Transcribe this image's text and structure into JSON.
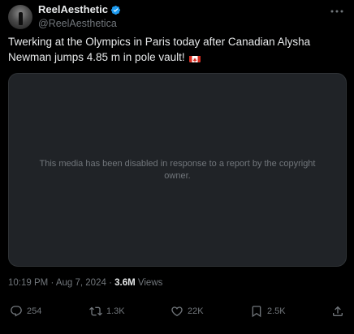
{
  "author": {
    "display_name": "ReelAesthetic",
    "handle": "@ReelAesthetica",
    "verified_icon": "verified-badge-icon",
    "avatar_icon": "profile-avatar"
  },
  "tweet": {
    "text": "Twerking at the Olympics in Paris today after Canadian Alysha Newman jumps 4.85 m in pole vault! ",
    "flag_icon": "canada-flag-icon"
  },
  "media": {
    "message": "This media has been disabled in response to a report by the copyright owner."
  },
  "meta": {
    "time": "10:19 PM",
    "separator": "·",
    "date": "Aug 7, 2024",
    "views_count": "3.6M",
    "views_label": "Views"
  },
  "actions": {
    "replies": "254",
    "reposts": "1.3K",
    "likes": "22K",
    "bookmarks": "2.5K"
  },
  "colors": {
    "background": "#000000",
    "primary_text": "#e7e9ea",
    "secondary_text": "#71767b",
    "verified_blue": "#1d9bf0",
    "media_background": "#202327"
  }
}
